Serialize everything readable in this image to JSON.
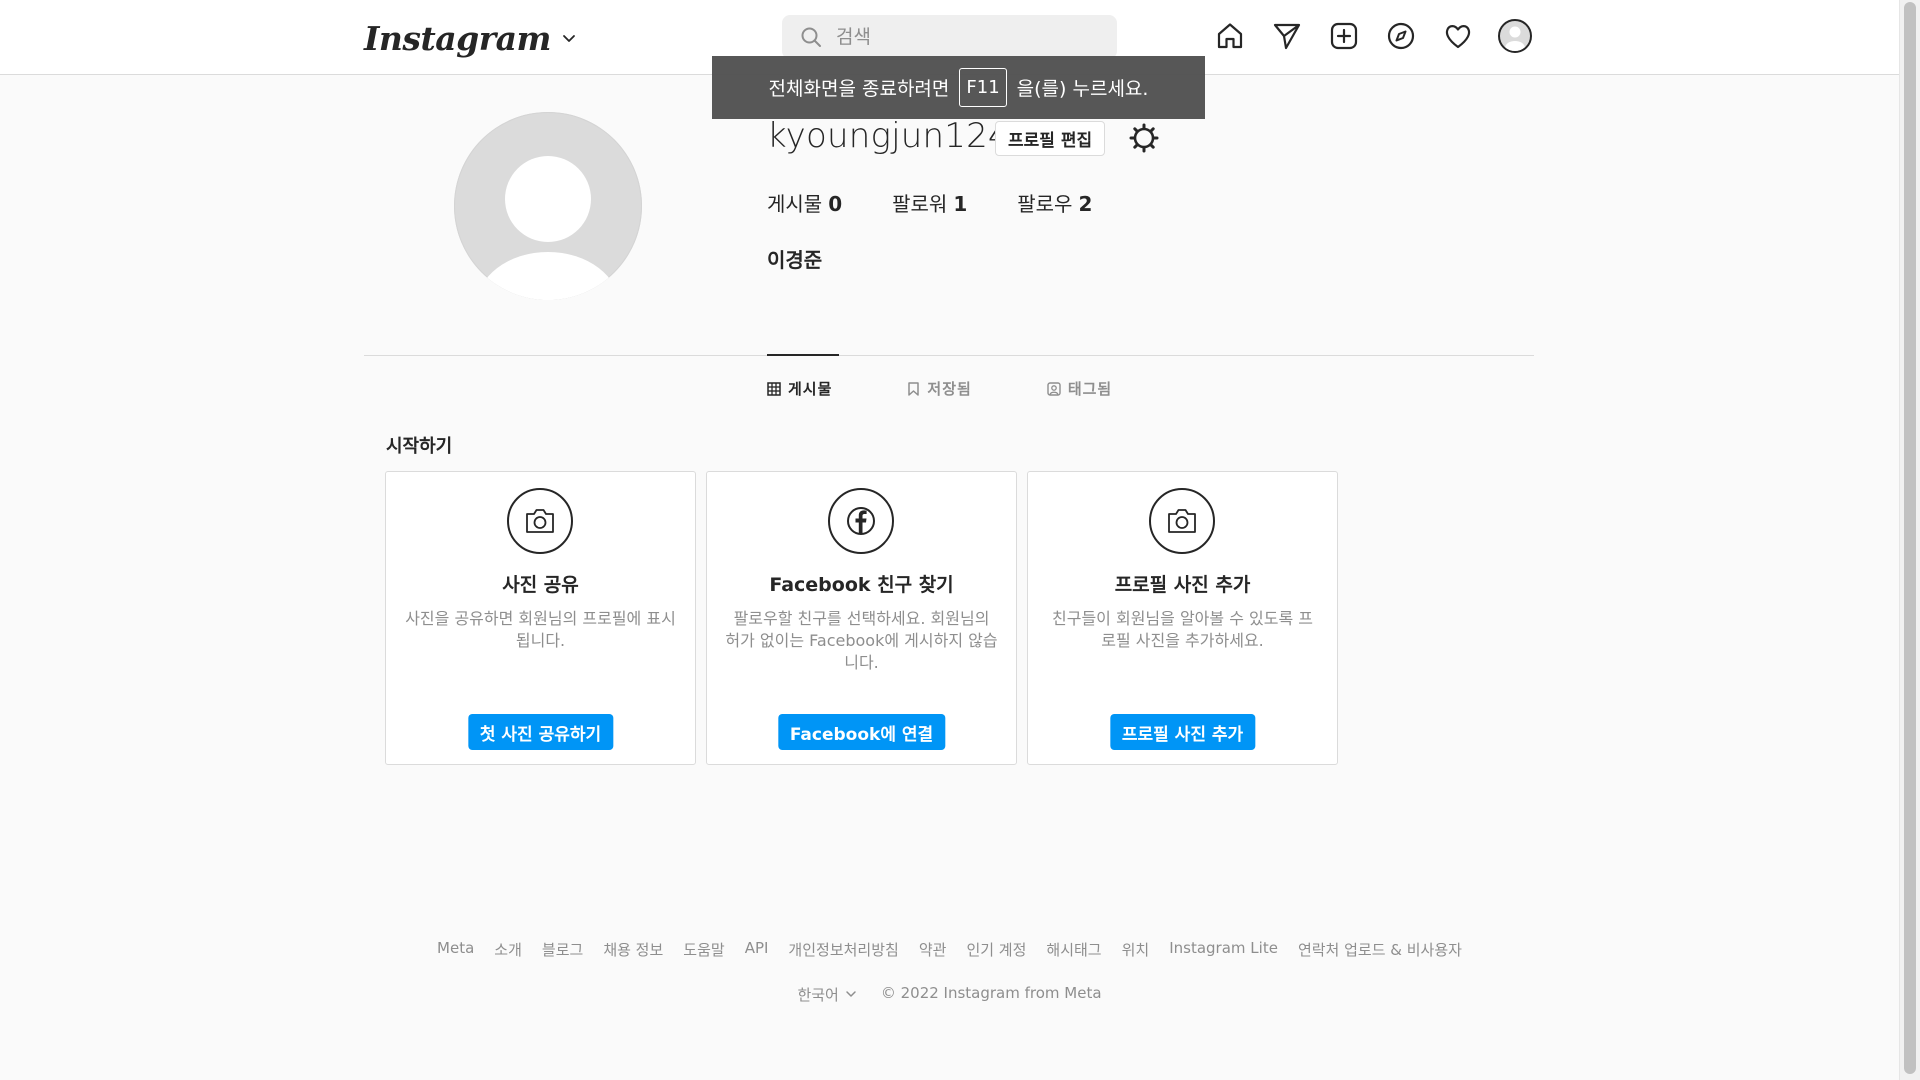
{
  "nav": {
    "logo": "Instagram",
    "search_placeholder": "검색",
    "icons": [
      "home-icon",
      "direct-icon",
      "new-post-icon",
      "explore-icon",
      "activity-icon",
      "profile-avatar"
    ]
  },
  "toast": {
    "before": "전체화면을 종료하려면",
    "key": "F11",
    "after": "을(를) 누르세요."
  },
  "profile": {
    "username": "kyoungjun124",
    "edit_label": "프로필 편집",
    "stats": [
      {
        "label": "게시물",
        "value": "0"
      },
      {
        "label": "팔로워",
        "value": "1"
      },
      {
        "label": "팔로우",
        "value": "2"
      }
    ],
    "full_name": "이경준"
  },
  "tabs": [
    {
      "label": "게시물",
      "icon": "grid-icon",
      "active": true
    },
    {
      "label": "저장됨",
      "icon": "bookmark-icon",
      "active": false
    },
    {
      "label": "태그됨",
      "icon": "tagged-icon",
      "active": false
    }
  ],
  "getting_started": {
    "title": "시작하기",
    "cards": [
      {
        "icon": "camera-icon",
        "title": "사진 공유",
        "desc": "사진을 공유하면 회원님의 프로필에 표시됩니다.",
        "button": "첫 사진 공유하기"
      },
      {
        "icon": "facebook-icon",
        "title": "Facebook 친구 찾기",
        "desc": "팔로우할 친구를 선택하세요. 회원님의 허가 없이는 Facebook에 게시하지 않습니다.",
        "button": "Facebook에 연결"
      },
      {
        "icon": "camera-icon",
        "title": "프로필 사진 추가",
        "desc": "친구들이 회원님을 알아볼 수 있도록 프로필 사진을 추가하세요.",
        "button": "프로필 사진 추가"
      }
    ]
  },
  "footer": {
    "links": [
      "Meta",
      "소개",
      "블로그",
      "채용 정보",
      "도움말",
      "API",
      "개인정보처리방침",
      "약관",
      "인기 계정",
      "해시태그",
      "위치",
      "Instagram Lite",
      "연락처 업로드 & 비사용자"
    ],
    "language": "한국어",
    "copyright": "© 2022 Instagram from Meta"
  },
  "colors": {
    "accent_button": "#0095f6",
    "text_primary": "#262626",
    "text_secondary": "#8e8e8e",
    "border": "#dbdbdb",
    "background": "#fafafa"
  }
}
